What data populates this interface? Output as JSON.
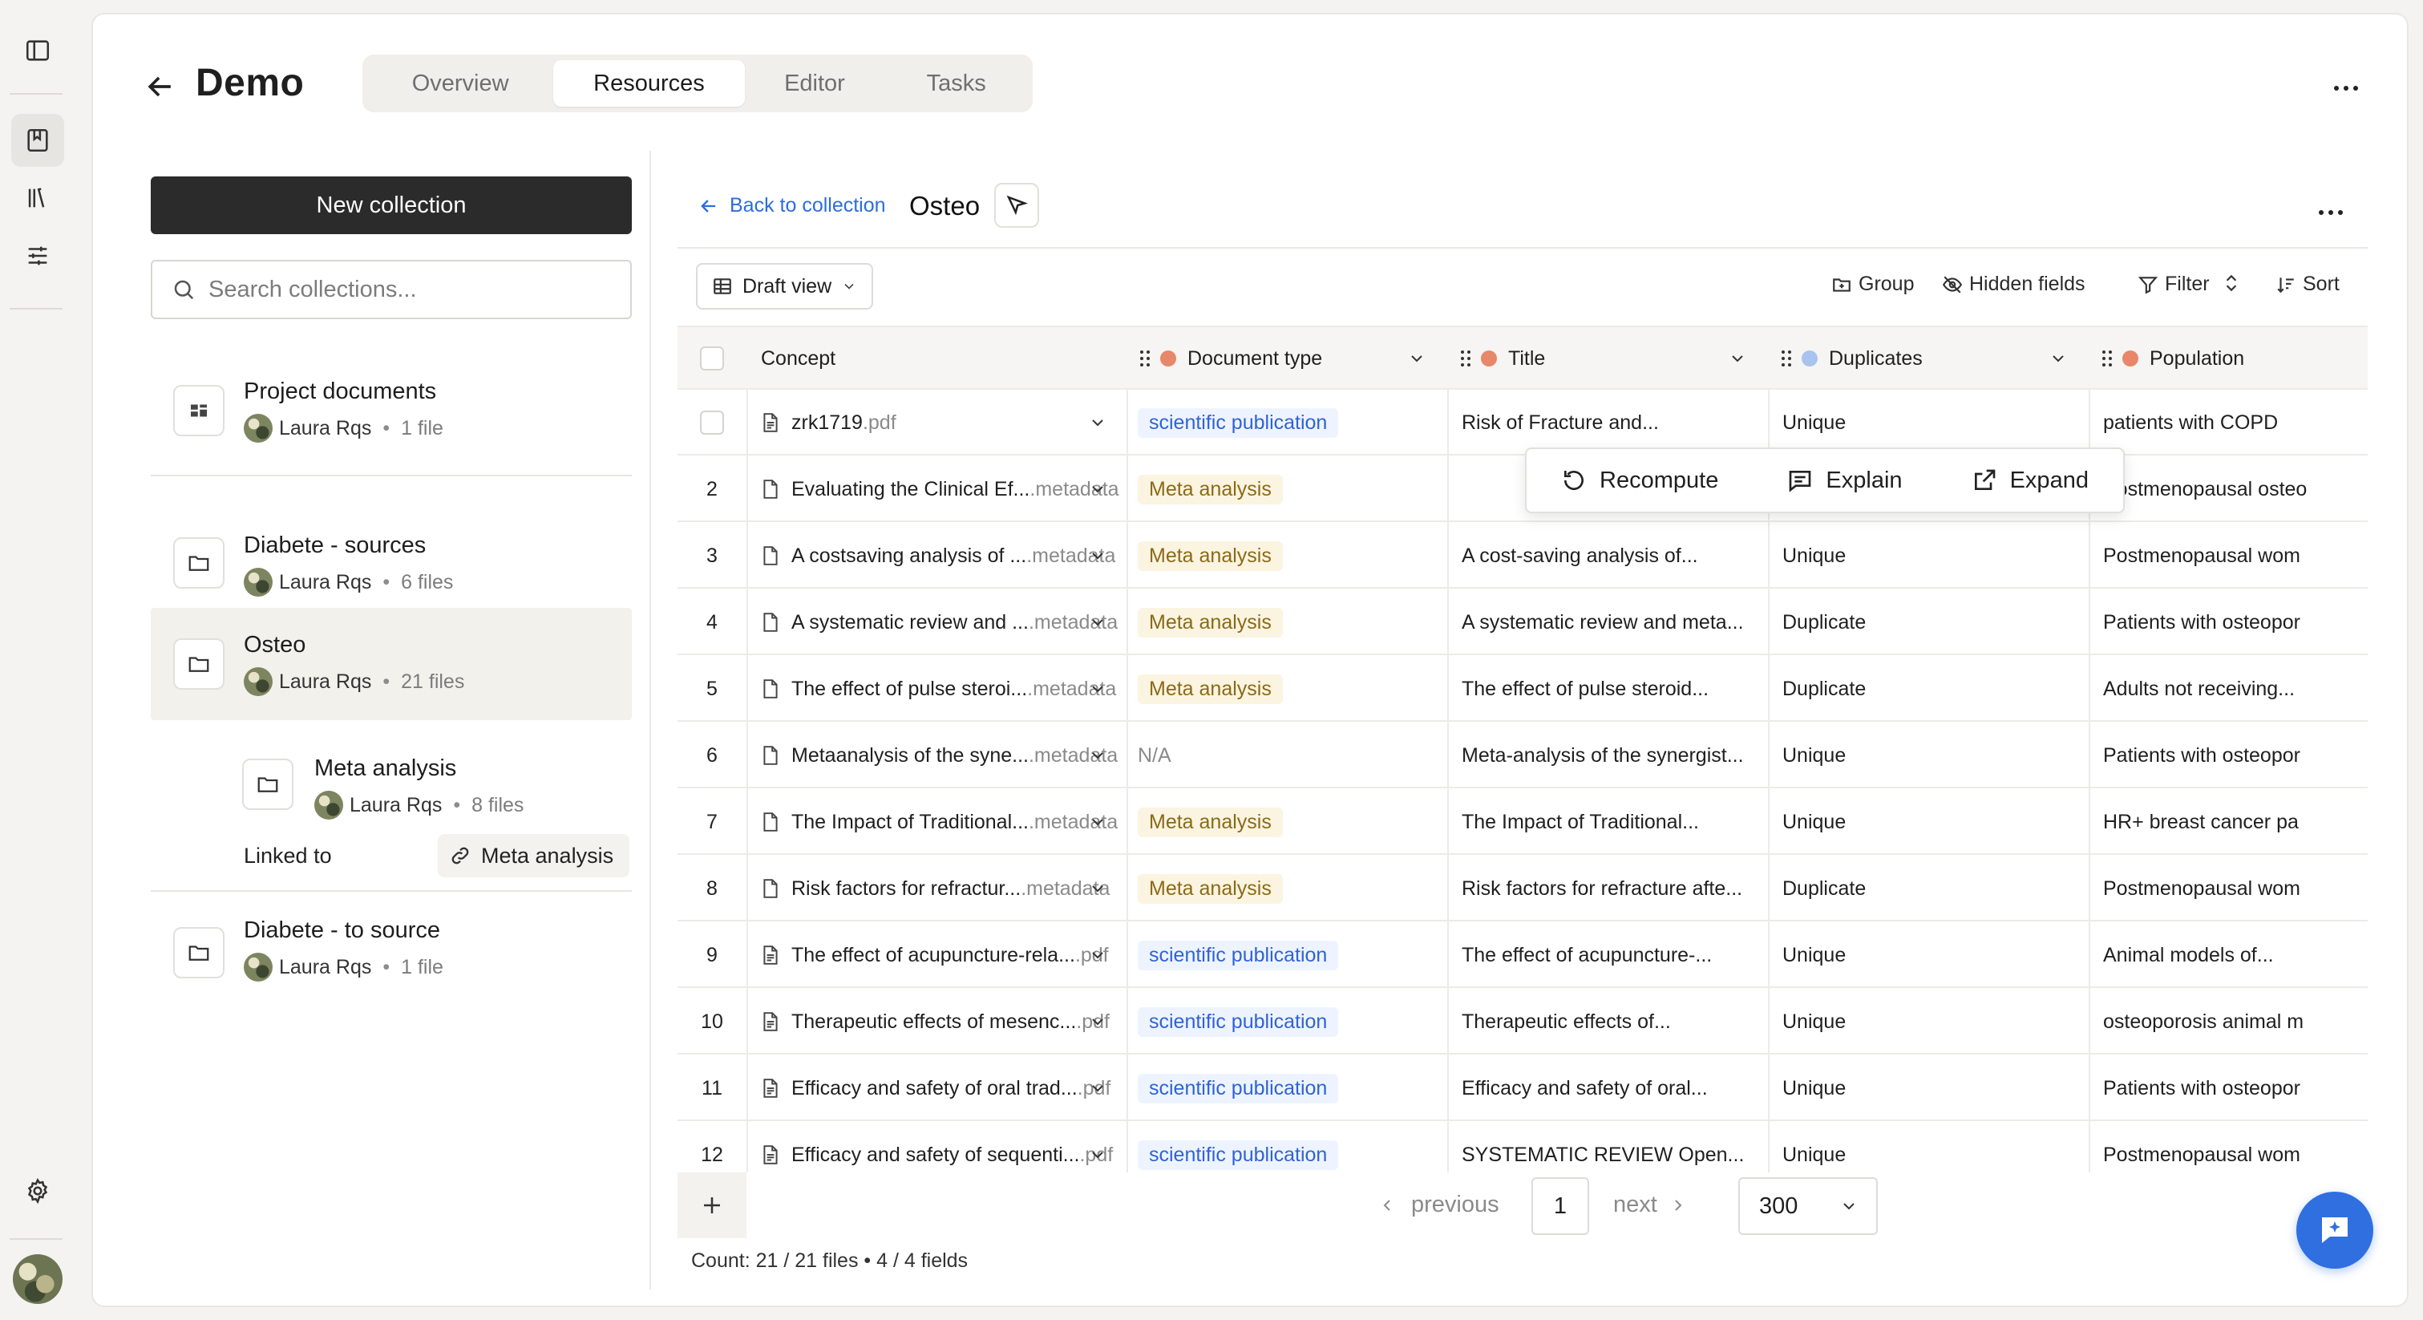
{
  "app": {
    "title": "Demo",
    "tabs": [
      {
        "label": "Overview",
        "active": false
      },
      {
        "label": "Resources",
        "active": true
      },
      {
        "label": "Editor",
        "active": false
      },
      {
        "label": "Tasks",
        "active": false
      }
    ]
  },
  "rail": {
    "icons": [
      "sidebar-toggle-icon",
      "bookmark-icon",
      "library-icon",
      "sliders-icon",
      "settings-icon"
    ]
  },
  "collections": {
    "new_button": "New collection",
    "search_placeholder": "Search collections...",
    "items": [
      {
        "name": "Project documents",
        "owner": "Laura Rqs",
        "files": "1 file"
      },
      {
        "name": "Diabete - sources",
        "owner": "Laura Rqs",
        "files": "6 files"
      },
      {
        "name": "Osteo",
        "owner": "Laura Rqs",
        "files": "21 files",
        "selected": true
      },
      {
        "name": "Meta analysis",
        "owner": "Laura Rqs",
        "files": "8 files"
      },
      {
        "name": "Diabete - to source",
        "owner": "Laura Rqs",
        "files": "1 file"
      }
    ],
    "linked_label": "Linked to",
    "linked_target": "Meta analysis"
  },
  "content": {
    "back_link": "Back to collection",
    "collection_title": "Osteo",
    "view_name": "Draft view",
    "toolbar": {
      "group": "Group",
      "hidden_fields": "Hidden fields",
      "filter": "Filter",
      "sort": "Sort"
    }
  },
  "table": {
    "columns": [
      "Concept",
      "Document type",
      "Title",
      "Duplicates",
      "Population"
    ],
    "rows": [
      {
        "num": "",
        "concept": "zrk1719",
        "ext": ".pdf",
        "doc_type": "scientific publication",
        "title": "Risk of Fracture and...",
        "dup": "Unique",
        "pop": "patients with COPD"
      },
      {
        "num": "2",
        "concept": "Evaluating the Clinical Ef...",
        "ext": ".metadata",
        "doc_type": "Meta analysis",
        "title": "",
        "dup": "",
        "pop": "Postmenopausal osteo"
      },
      {
        "num": "3",
        "concept": "A costsaving analysis of ...",
        "ext": ".metadata",
        "doc_type": "Meta analysis",
        "title": "A cost-saving analysis of...",
        "dup": "Unique",
        "pop": "Postmenopausal wom"
      },
      {
        "num": "4",
        "concept": "A systematic review and ...",
        "ext": ".metadata",
        "doc_type": "Meta analysis",
        "title": "A systematic review and meta...",
        "dup": "Duplicate",
        "pop": "Patients with osteopor"
      },
      {
        "num": "5",
        "concept": "The effect of pulse steroi...",
        "ext": ".metadata",
        "doc_type": "Meta analysis",
        "title": "The effect of pulse steroid...",
        "dup": "Duplicate",
        "pop": "Adults not receiving..."
      },
      {
        "num": "6",
        "concept": "Metaanalysis of the syne...",
        "ext": ".metadata",
        "doc_type": "N/A",
        "title": "Meta-analysis of the synergist...",
        "dup": "Unique",
        "pop": "Patients with osteopor"
      },
      {
        "num": "7",
        "concept": "The Impact of Traditional...",
        "ext": ".metadata",
        "doc_type": "Meta analysis",
        "title": "The Impact of Traditional...",
        "dup": "Unique",
        "pop": "HR+ breast cancer pa"
      },
      {
        "num": "8",
        "concept": "Risk factors for refractur...",
        "ext": ".metadata",
        "doc_type": "Meta analysis",
        "title": "Risk factors for refracture afte...",
        "dup": "Duplicate",
        "pop": "Postmenopausal wom"
      },
      {
        "num": "9",
        "concept": "The effect of acupuncture-rela...",
        "ext": ".pdf",
        "doc_type": "scientific publication",
        "title": "The effect of acupuncture-...",
        "dup": "Unique",
        "pop": "Animal models of..."
      },
      {
        "num": "10",
        "concept": "Therapeutic effects of mesenc...",
        "ext": ".pdf",
        "doc_type": "scientific publication",
        "title": "Therapeutic effects of...",
        "dup": "Unique",
        "pop": "osteoporosis animal m"
      },
      {
        "num": "11",
        "concept": "Efficacy and safety of oral trad...",
        "ext": ".pdf",
        "doc_type": "scientific publication",
        "title": "Efficacy and safety of oral...",
        "dup": "Unique",
        "pop": "Patients with osteopor"
      },
      {
        "num": "12",
        "concept": "Efficacy and safety of sequenti...",
        "ext": ".pdf",
        "doc_type": "scientific publication",
        "title": "SYSTEMATIC REVIEW Open...",
        "dup": "Unique",
        "pop": "Postmenopausal wom"
      }
    ]
  },
  "popover": {
    "recompute": "Recompute",
    "explain": "Explain",
    "expand": "Expand"
  },
  "pagination": {
    "previous": "previous",
    "page": "1",
    "next": "next",
    "page_size": "300"
  },
  "footer": {
    "count": "Count: 21 / 21 files • 4 / 4 fields"
  },
  "colors": {
    "accent_blue": "#2f6fe0",
    "link_blue": "#2b6ddf",
    "meta_badge_bg": "#fbf4e1",
    "sci_badge_bg": "#eef4ff",
    "header_dot_orange": "#e8876a",
    "header_dot_blue": "#a9c3ef"
  }
}
